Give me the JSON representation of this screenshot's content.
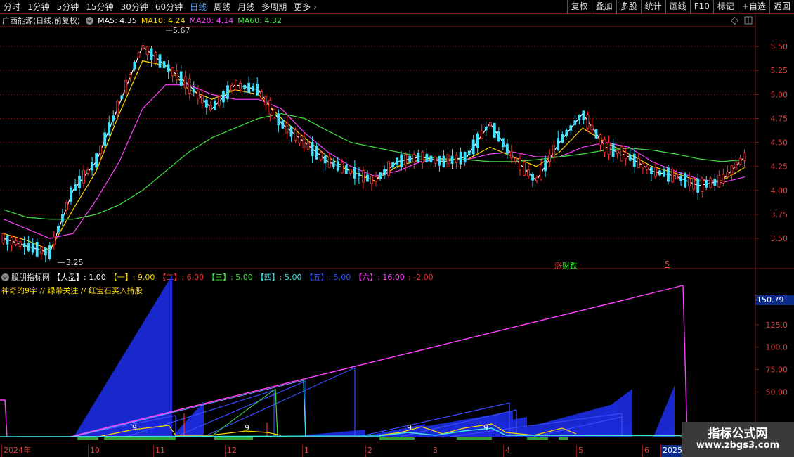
{
  "toolbar": {
    "periods": [
      "分时",
      "1分钟",
      "5分钟",
      "15分钟",
      "30分钟",
      "60分钟",
      "日线",
      "周线",
      "月线",
      "多周期",
      "更多"
    ],
    "active_period": "日线",
    "buttons": [
      "复权",
      "叠加",
      "多股",
      "统计",
      "画线",
      "F10",
      "标记",
      "+自选",
      "返回"
    ]
  },
  "main_panel": {
    "title": "广西能源(日线,前复权)",
    "ma5": "MA5: 4.35",
    "ma10": "MA10: 4.24",
    "ma20": "MA20: 4.14",
    "ma60": "MA60: 4.32",
    "high_label": "5.67",
    "low_label": "3.25",
    "marker_zhang": "涨",
    "marker_cai": "财",
    "marker_die": "跌",
    "marker_s": "S",
    "colors": {
      "ma5": "#ffffff",
      "ma10": "#ffd700",
      "ma20": "#ff40ff",
      "ma60": "#40e040",
      "up": "#ff3030",
      "down": "#40e0ff",
      "grid": "#7a1a1a"
    }
  },
  "sub_panel": {
    "name": "股朋指标网",
    "items": [
      {
        "label": "【大盘】: 1.00",
        "color": "#ffffff"
      },
      {
        "label": "【一】: 9.00",
        "color": "#ffd700"
      },
      {
        "label": "【二】: 6.00",
        "color": "#ff3030"
      },
      {
        "label": "【三】: 5.00",
        "color": "#40e040"
      },
      {
        "label": "【四】: 5.00",
        "color": "#40e0e0"
      },
      {
        "label": "【五】: 5.00",
        "color": "#3050ff"
      },
      {
        "label": "【六】: 16.00",
        "color": "#ff40ff"
      },
      {
        "label": ": -2.00",
        "color": "#ff3030"
      }
    ],
    "note": "神奇的9字 // 绿带关注 // 红宝石买入持股",
    "last_value": "150.79",
    "nine_labels": [
      "9",
      "9",
      "9",
      "9"
    ]
  },
  "axes": {
    "price_ticks": [
      "5.50",
      "5.25",
      "5.00",
      "4.75",
      "4.50",
      "4.25",
      "4.00",
      "3.75",
      "3.50"
    ],
    "sub_ticks": [
      "150.0",
      "125.0",
      "100.0",
      "75.00",
      "50.00"
    ],
    "dates": [
      "2024年",
      "10",
      "11",
      "12",
      "1",
      "2",
      "3",
      "4",
      "5",
      "6",
      "2025/"
    ]
  },
  "watermark": {
    "title": "指标公式网",
    "url": "www.zbgs3.com"
  },
  "chart_data": {
    "type": "line",
    "title": "广西能源(日线,前复权)",
    "ylim": [
      3.2,
      5.75
    ],
    "x": [
      "2024年",
      "10",
      "11",
      "12",
      "1",
      "2",
      "3",
      "4",
      "5",
      "6",
      "2025/"
    ],
    "series": [
      {
        "name": "MA5",
        "values": [
          3.5,
          3.42,
          3.35,
          4.0,
          4.3,
          4.9,
          5.5,
          5.3,
          5.1,
          4.85,
          5.1,
          5.05,
          4.7,
          4.5,
          4.3,
          4.2,
          4.1,
          4.3,
          4.35,
          4.3,
          4.35,
          4.7,
          4.35,
          4.1,
          4.5,
          4.8,
          4.45,
          4.35,
          4.2,
          4.15,
          4.05,
          4.1,
          4.35
        ]
      },
      {
        "name": "MA10",
        "values": [
          3.55,
          3.48,
          3.38,
          3.8,
          4.2,
          4.8,
          5.35,
          5.3,
          5.05,
          4.95,
          5.05,
          5.0,
          4.75,
          4.55,
          4.35,
          4.2,
          4.1,
          4.25,
          4.32,
          4.32,
          4.32,
          4.45,
          4.35,
          4.25,
          4.4,
          4.65,
          4.5,
          4.38,
          4.25,
          4.18,
          4.1,
          4.1,
          4.24
        ]
      },
      {
        "name": "MA20",
        "values": [
          3.7,
          3.6,
          3.5,
          3.55,
          3.9,
          4.3,
          4.85,
          5.1,
          5.1,
          5.0,
          4.95,
          4.95,
          4.85,
          4.6,
          4.4,
          4.25,
          4.15,
          4.2,
          4.3,
          4.33,
          4.32,
          4.38,
          4.4,
          4.35,
          4.35,
          4.45,
          4.5,
          4.45,
          4.3,
          4.2,
          4.12,
          4.08,
          4.14
        ]
      },
      {
        "name": "MA60",
        "values": [
          3.8,
          3.72,
          3.7,
          3.7,
          3.75,
          3.85,
          4.0,
          4.2,
          4.4,
          4.55,
          4.65,
          4.75,
          4.8,
          4.75,
          4.62,
          4.5,
          4.45,
          4.4,
          4.35,
          4.33,
          4.32,
          4.3,
          4.3,
          4.32,
          4.35,
          4.38,
          4.42,
          4.44,
          4.42,
          4.38,
          4.33,
          4.3,
          4.32
        ]
      }
    ]
  }
}
